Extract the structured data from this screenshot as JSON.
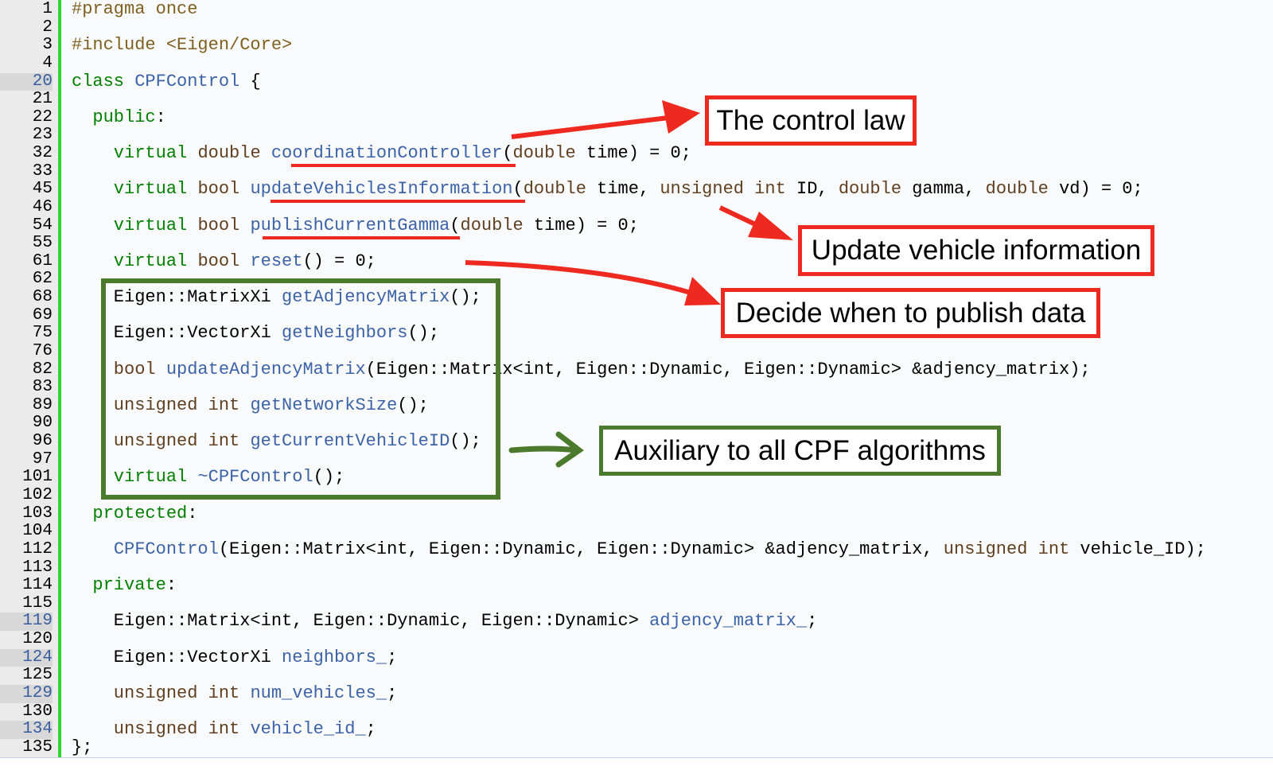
{
  "colors": {
    "keyword": "#008000",
    "type": "#604020",
    "name": "#3c62a8",
    "preprocessor": "#806020",
    "annotation_red": "#ee2a20",
    "annotation_green": "#4c7a2c",
    "gutter_bar": "#2fd62f"
  },
  "lines": [
    {
      "num": "1",
      "tokens": [
        {
          "t": "#pragma once",
          "c": "p"
        }
      ]
    },
    {
      "num": "2",
      "tokens": []
    },
    {
      "num": "3",
      "tokens": [
        {
          "t": "#include <Eigen/Core>",
          "c": "p"
        }
      ]
    },
    {
      "num": "4",
      "tokens": []
    },
    {
      "num": "20",
      "hl": true,
      "tokens": [
        {
          "t": "class ",
          "c": "k"
        },
        {
          "t": "CPFControl",
          "c": "n"
        },
        {
          "t": " {",
          "c": "x"
        }
      ]
    },
    {
      "num": "21",
      "tokens": []
    },
    {
      "num": "22",
      "tokens": [
        {
          "t": "  public",
          "c": "k"
        },
        {
          "t": ":",
          "c": "x"
        }
      ]
    },
    {
      "num": "23",
      "tokens": []
    },
    {
      "num": "32",
      "tokens": [
        {
          "t": "    virtual ",
          "c": "k"
        },
        {
          "t": "double ",
          "c": "t"
        },
        {
          "t": "coordinationController",
          "c": "n"
        },
        {
          "t": "(",
          "c": "x"
        },
        {
          "t": "double",
          "c": "t"
        },
        {
          "t": " time) = 0;",
          "c": "x"
        }
      ]
    },
    {
      "num": "33",
      "tokens": []
    },
    {
      "num": "45",
      "tokens": [
        {
          "t": "    virtual ",
          "c": "k"
        },
        {
          "t": "bool ",
          "c": "t"
        },
        {
          "t": "updateVehiclesInformation",
          "c": "n"
        },
        {
          "t": "(",
          "c": "x"
        },
        {
          "t": "double",
          "c": "t"
        },
        {
          "t": " time, ",
          "c": "x"
        },
        {
          "t": "unsigned int",
          "c": "t"
        },
        {
          "t": " ID, ",
          "c": "x"
        },
        {
          "t": "double",
          "c": "t"
        },
        {
          "t": " gamma, ",
          "c": "x"
        },
        {
          "t": "double",
          "c": "t"
        },
        {
          "t": " vd) = 0;",
          "c": "x"
        }
      ]
    },
    {
      "num": "46",
      "tokens": []
    },
    {
      "num": "54",
      "tokens": [
        {
          "t": "    virtual ",
          "c": "k"
        },
        {
          "t": "bool ",
          "c": "t"
        },
        {
          "t": "publishCurrentGamma",
          "c": "n"
        },
        {
          "t": "(",
          "c": "x"
        },
        {
          "t": "double",
          "c": "t"
        },
        {
          "t": " time) = 0;",
          "c": "x"
        }
      ]
    },
    {
      "num": "55",
      "tokens": []
    },
    {
      "num": "61",
      "tokens": [
        {
          "t": "    virtual ",
          "c": "k"
        },
        {
          "t": "bool ",
          "c": "t"
        },
        {
          "t": "reset",
          "c": "n"
        },
        {
          "t": "() = 0;",
          "c": "x"
        }
      ]
    },
    {
      "num": "62",
      "tokens": []
    },
    {
      "num": "68",
      "tokens": [
        {
          "t": "    Eigen::MatrixXi ",
          "c": "x"
        },
        {
          "t": "getAdjencyMatrix",
          "c": "n"
        },
        {
          "t": "();",
          "c": "x"
        }
      ]
    },
    {
      "num": "69",
      "tokens": []
    },
    {
      "num": "75",
      "tokens": [
        {
          "t": "    Eigen::VectorXi ",
          "c": "x"
        },
        {
          "t": "getNeighbors",
          "c": "n"
        },
        {
          "t": "();",
          "c": "x"
        }
      ]
    },
    {
      "num": "76",
      "tokens": []
    },
    {
      "num": "82",
      "tokens": [
        {
          "t": "    bool ",
          "c": "t"
        },
        {
          "t": "updateAdjencyMatrix",
          "c": "n"
        },
        {
          "t": "(Eigen::Matrix<int, Eigen::Dynamic, Eigen::Dynamic> &adjency_matrix);",
          "c": "x"
        }
      ]
    },
    {
      "num": "83",
      "tokens": []
    },
    {
      "num": "89",
      "tokens": [
        {
          "t": "    unsigned int ",
          "c": "t"
        },
        {
          "t": "getNetworkSize",
          "c": "n"
        },
        {
          "t": "();",
          "c": "x"
        }
      ]
    },
    {
      "num": "90",
      "tokens": []
    },
    {
      "num": "96",
      "tokens": [
        {
          "t": "    unsigned int ",
          "c": "t"
        },
        {
          "t": "getCurrentVehicleID",
          "c": "n"
        },
        {
          "t": "();",
          "c": "x"
        }
      ]
    },
    {
      "num": "97",
      "tokens": []
    },
    {
      "num": "101",
      "tokens": [
        {
          "t": "    virtual ",
          "c": "k"
        },
        {
          "t": "~CPFControl",
          "c": "n"
        },
        {
          "t": "();",
          "c": "x"
        }
      ]
    },
    {
      "num": "102",
      "tokens": []
    },
    {
      "num": "103",
      "tokens": [
        {
          "t": "  protected",
          "c": "k"
        },
        {
          "t": ":",
          "c": "x"
        }
      ]
    },
    {
      "num": "104",
      "tokens": []
    },
    {
      "num": "112",
      "tokens": [
        {
          "t": "    ",
          "c": "x"
        },
        {
          "t": "CPFControl",
          "c": "n"
        },
        {
          "t": "(Eigen::Matrix<int, Eigen::Dynamic, Eigen::Dynamic> &adjency_matrix, ",
          "c": "x"
        },
        {
          "t": "unsigned int",
          "c": "t"
        },
        {
          "t": " vehicle_ID);",
          "c": "x"
        }
      ]
    },
    {
      "num": "113",
      "tokens": []
    },
    {
      "num": "114",
      "tokens": [
        {
          "t": "  private",
          "c": "k"
        },
        {
          "t": ":",
          "c": "x"
        }
      ]
    },
    {
      "num": "115",
      "tokens": []
    },
    {
      "num": "119",
      "hl": true,
      "tokens": [
        {
          "t": "    Eigen::Matrix<int, Eigen::Dynamic, Eigen::Dynamic> ",
          "c": "x"
        },
        {
          "t": "adjency_matrix_",
          "c": "n"
        },
        {
          "t": ";",
          "c": "x"
        }
      ]
    },
    {
      "num": "120",
      "tokens": []
    },
    {
      "num": "124",
      "hl": true,
      "tokens": [
        {
          "t": "    Eigen::VectorXi ",
          "c": "x"
        },
        {
          "t": "neighbors_",
          "c": "n"
        },
        {
          "t": ";",
          "c": "x"
        }
      ]
    },
    {
      "num": "125",
      "tokens": []
    },
    {
      "num": "129",
      "hl": true,
      "tokens": [
        {
          "t": "    unsigned int ",
          "c": "t"
        },
        {
          "t": "num_vehicles_",
          "c": "n"
        },
        {
          "t": ";",
          "c": "x"
        }
      ]
    },
    {
      "num": "130",
      "tokens": []
    },
    {
      "num": "134",
      "hl": true,
      "tokens": [
        {
          "t": "    unsigned int ",
          "c": "t"
        },
        {
          "t": "vehicle_id_",
          "c": "n"
        },
        {
          "t": ";",
          "c": "x"
        }
      ]
    },
    {
      "num": "135",
      "tokens": [
        {
          "t": "};",
          "c": "x"
        }
      ]
    }
  ],
  "annotations": {
    "control_law": "The control law",
    "update_info": "Update vehicle information",
    "publish": "Decide when to publish data",
    "auxiliary": "Auxiliary to all CPF algorithms"
  }
}
